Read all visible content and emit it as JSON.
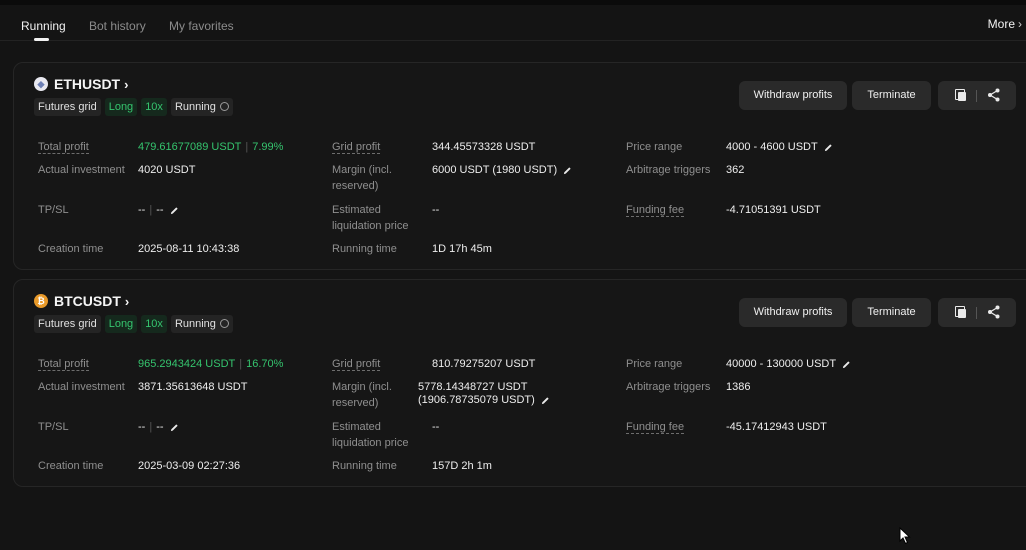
{
  "tabs": [
    {
      "label": "Running",
      "active": true
    },
    {
      "label": "Bot history",
      "active": false
    },
    {
      "label": "My favorites",
      "active": false
    }
  ],
  "more_label": "More",
  "buttons": {
    "withdraw": "Withdraw profits",
    "terminate": "Terminate"
  },
  "labels": {
    "total_profit": "Total profit",
    "actual_investment": "Actual investment",
    "tpsl": "TP/SL",
    "creation_time": "Creation time",
    "grid_profit": "Grid profit",
    "margin": "Margin (incl. reserved)",
    "est_liq": "Estimated liquidation price",
    "running_time": "Running time",
    "price_range": "Price range",
    "arb_triggers": "Arbitrage triggers",
    "funding_fee": "Funding fee"
  },
  "bots": [
    {
      "pair": "ETHUSDT",
      "coin_icon": "eth-icon",
      "tags": [
        "Futures grid",
        "Long",
        "10x",
        "Running"
      ],
      "total_profit_usdt": "479.61677089 USDT",
      "total_profit_pct": "7.99%",
      "actual_investment": "4020 USDT",
      "tpsl_tp": "--",
      "tpsl_sl": "--",
      "creation_time": "2025-08-11 10:43:38",
      "grid_profit": "344.45573328 USDT",
      "margin_line1": "6000 USDT (1980 USDT)",
      "margin_line2": "",
      "est_liq": "--",
      "running_time": "1D 17h 45m",
      "price_range": "4000 - 4600 USDT",
      "arb_triggers": "362",
      "funding_fee": "-4.71051391 USDT"
    },
    {
      "pair": "BTCUSDT",
      "coin_icon": "btc-icon",
      "tags": [
        "Futures grid",
        "Long",
        "10x",
        "Running"
      ],
      "total_profit_usdt": "965.2943424 USDT",
      "total_profit_pct": "16.70%",
      "actual_investment": "3871.35613648 USDT",
      "tpsl_tp": "--",
      "tpsl_sl": "--",
      "creation_time": "2025-03-09 02:27:36",
      "grid_profit": "810.79275207 USDT",
      "margin_line1": "5778.14348727 USDT",
      "margin_line2": "(1906.78735079 USDT)",
      "est_liq": "--",
      "running_time": "157D 2h 1m",
      "price_range": "40000 - 130000 USDT",
      "arb_triggers": "1386",
      "funding_fee": "-45.17412943 USDT"
    }
  ],
  "colors": {
    "profit_green": "#35c46e",
    "background": "#141414",
    "button": "#2a2a2a"
  }
}
